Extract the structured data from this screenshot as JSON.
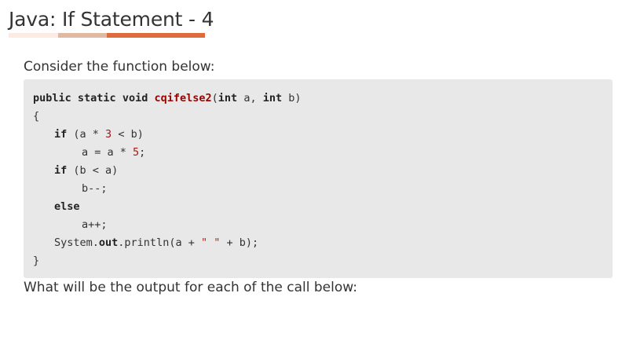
{
  "page": {
    "title": "Java: If Statement - 4",
    "intro": "Consider the function below:",
    "question": "What will be the output for each of the call below:"
  },
  "colors": {
    "underline_light": "#fdebe3",
    "underline_mid": "#e0b9a4",
    "underline_accent": "#dd6b3e",
    "code_background": "#e8e8e8"
  },
  "code": {
    "line1": {
      "kw1": "public",
      "kw2": "static",
      "kw3": "void",
      "fn": "cqifelse2",
      "open": "(",
      "kw4": "int",
      "p1": " a, ",
      "kw5": "int",
      "p2": " b)"
    },
    "line2": "{",
    "line3": {
      "kw": "if",
      "pre": " (a * ",
      "num": "3",
      "post": " < b)"
    },
    "line4": {
      "pre": "a = a * ",
      "num": "5",
      "post": ";"
    },
    "line5": {
      "kw": "if",
      "rest": " (b < a)"
    },
    "line6": "b--;",
    "line7": "else",
    "line8": "a++;",
    "line9": {
      "obj": "System.",
      "field": "out",
      "call": ".println(a + ",
      "str": "\" \"",
      "end": " + b);"
    },
    "line10": "}"
  }
}
